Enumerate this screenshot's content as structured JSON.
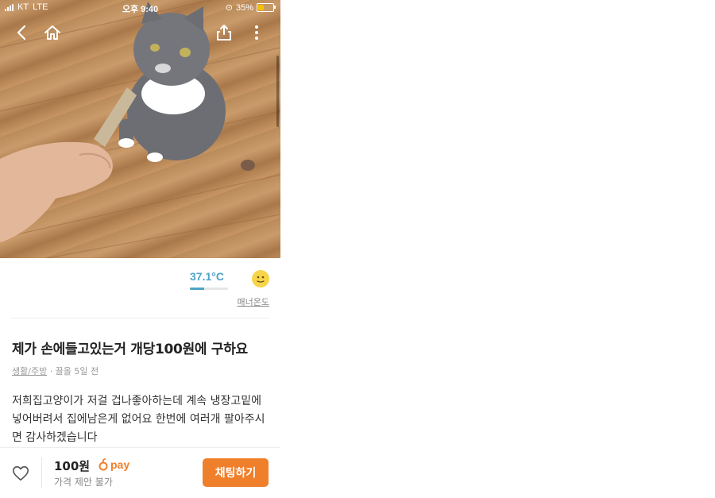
{
  "status_bar": {
    "carrier": "KT",
    "network": "LTE",
    "time": "오후 9:40",
    "battery": "35%"
  },
  "manner": {
    "temperature": "37.1°C",
    "label": "매너온도",
    "level_percent": 37
  },
  "post": {
    "title": "제가 손에들고있는거 개당100원에 구하요",
    "category": "생활/주방",
    "time": "· 끌올 5일 전",
    "body": "저희집고양이가 저걸 겁나좋아하는데 계속 냉장고밑에 넣어버려서 집에남은게 없어요 한번에 여러개 팔아주시면 감사하겠습니다"
  },
  "bottom_bar": {
    "price": "100원",
    "pay_label": "pay",
    "negotiation": "가격 제안 불가",
    "chat_button": "채팅하기"
  },
  "colors": {
    "accent": "#f07f2b",
    "temperature": "#4fa3c9"
  }
}
